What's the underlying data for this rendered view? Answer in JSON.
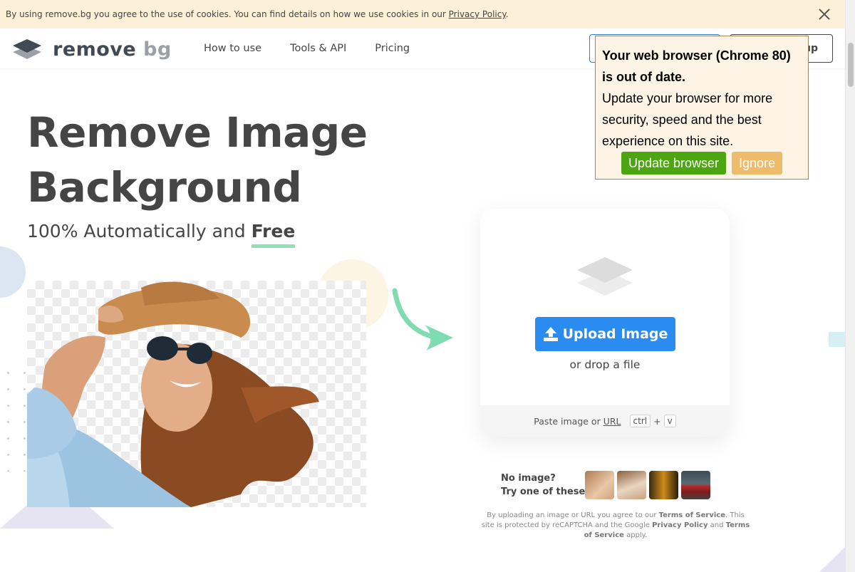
{
  "cookie": {
    "text": "By using remove.bg you agree to the use of cookies. You can find details on how we use cookies in our ",
    "link": "Privacy Policy",
    "end": "."
  },
  "header": {
    "logo_remove": "remove",
    "logo_bg": "bg",
    "nav": [
      "How to use",
      "Tools & API",
      "Pricing"
    ],
    "signup_label": "up"
  },
  "update_popup": {
    "title": "Your web browser (Chrome 80) is out of date.",
    "body": "Update your browser for more security, speed and the best experience on this site.",
    "update_label": "Update browser",
    "ignore_label": "Ignore"
  },
  "hero": {
    "title_line1": "Remove Image",
    "title_line2": "Background",
    "subtitle": "100% Automatically and ",
    "subtitle_bold": "Free"
  },
  "upload": {
    "button_label": "Upload Image",
    "drop_text": "or drop a file",
    "paste_text": "Paste image or",
    "paste_url": "URL",
    "key_ctrl": "ctrl",
    "key_plus": "+",
    "key_v": "v"
  },
  "samples": {
    "line1": "No image?",
    "line2": "Try one of these:"
  },
  "legal": {
    "p1": "By uploading an image or URL you agree to our ",
    "tos": "Terms of Service",
    "p2": ". This site is protected by reCAPTCHA and the Google ",
    "privacy": "Privacy Policy",
    "p3": " and ",
    "tos2": "Terms of Service",
    "p4": " apply."
  },
  "colors": {
    "accent_blue": "#2a8cf0",
    "accent_green": "#8ee0b8",
    "update_green": "#4ca511",
    "ignore_orange": "#eebb6a"
  }
}
